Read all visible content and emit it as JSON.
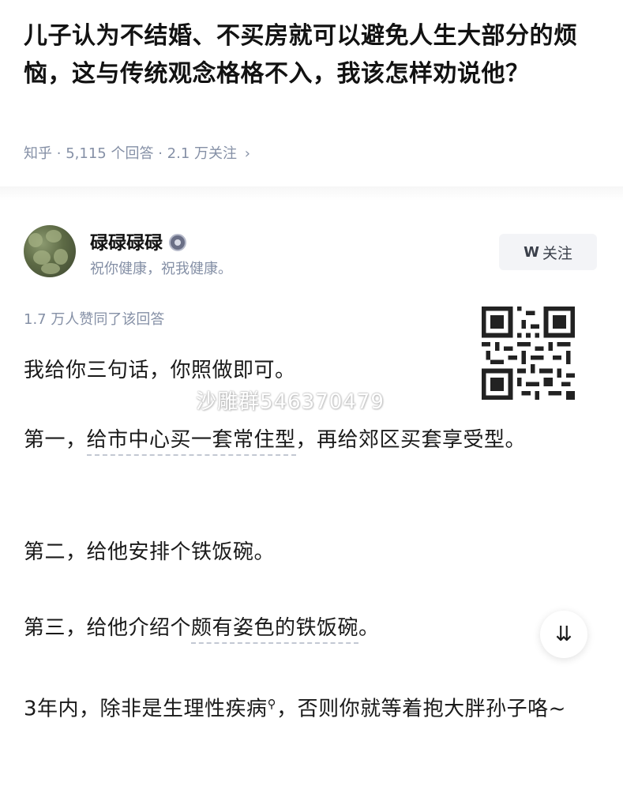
{
  "question": {
    "title": "儿子认为不结婚、不买房就可以避免人生大部分的烦恼，这与传统观念格格不入，我该怎样劝说他？"
  },
  "meta": {
    "source": "知乎",
    "answers": "5,115 个回答",
    "followers": "2.1 万关注",
    "chevron_icon": "chevron-right-icon"
  },
  "author": {
    "name": "碌碌碌碌",
    "bio": "祝你健康，祝我健康。",
    "badge_icon": "verified-badge-icon"
  },
  "follow_button": {
    "icon": "W",
    "label": "关注"
  },
  "likes": "1.7 万人赞同了该回答",
  "watermark": "沙雕群546370479",
  "answer": {
    "intro": "我给你三句话，你照做即可。",
    "first_prefix": "第一，",
    "first_link": "给市中心买一套常住型",
    "first_suffix": "，再给郊区买套享受型。",
    "second": "第二，给他安排个铁饭碗。",
    "third_prefix": "第三，给他介绍个",
    "third_link": "颇有姿色的铁饭碗",
    "third_suffix": "。",
    "last_prefix": "3年内，除非是",
    "last_link": "生理性疾病",
    "last_suffix": "，否则你就等着抱大胖孙子咯~"
  },
  "fold_button": {
    "icon": "double-chevron-down-icon",
    "glyph": "⌄"
  },
  "colors": {
    "meta_gray": "#8590a6",
    "follow_bg": "#f3f4f7",
    "text": "#1a1a1a"
  }
}
